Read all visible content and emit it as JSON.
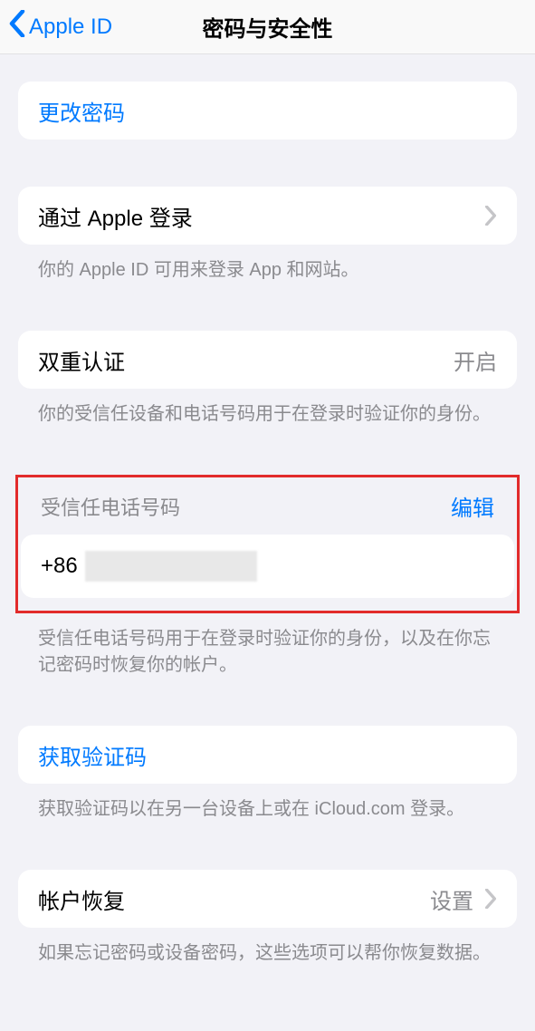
{
  "nav": {
    "back_label": "Apple ID",
    "title": "密码与安全性"
  },
  "change_password": {
    "label": "更改密码"
  },
  "sign_in_with_apple": {
    "label": "通过 Apple 登录",
    "footer": "你的 Apple ID 可用来登录 App 和网站。"
  },
  "two_factor": {
    "label": "双重认证",
    "value": "开启",
    "footer": "你的受信任设备和电话号码用于在登录时验证你的身份。"
  },
  "trusted_phone": {
    "header": "受信任电话号码",
    "edit": "编辑",
    "prefix": "+86",
    "footer": "受信任电话号码用于在登录时验证你的身份，以及在你忘记密码时恢复你的帐户。"
  },
  "get_code": {
    "label": "获取验证码",
    "footer": "获取验证码以在另一台设备上或在 iCloud.com 登录。"
  },
  "account_recovery": {
    "label": "帐户恢复",
    "value": "设置",
    "footer": "如果忘记密码或设备密码，这些选项可以帮你恢复数据。"
  }
}
